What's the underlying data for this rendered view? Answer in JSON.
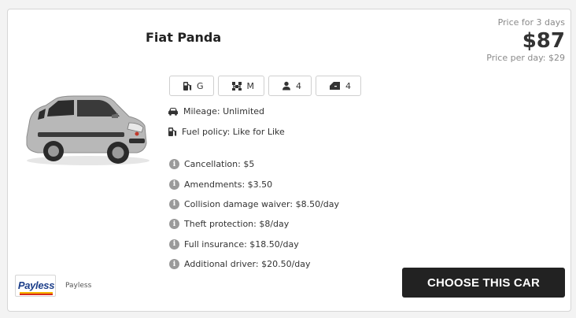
{
  "car": {
    "name": "Fiat Panda"
  },
  "price": {
    "caption": "Price for 3 days",
    "total": "$87",
    "per_day": "Price per day: $29"
  },
  "features": [
    {
      "icon": "fuel-pump-icon",
      "value": "G"
    },
    {
      "icon": "gearbox-icon",
      "value": "M"
    },
    {
      "icon": "person-icon",
      "value": "4"
    },
    {
      "icon": "car-door-icon",
      "value": "4"
    }
  ],
  "mileage": "Mileage: Unlimited",
  "fuel_policy": "Fuel policy: Like for Like",
  "extras": [
    "Cancellation: $5",
    "Amendments: $3.50",
    "Collision damage waiver: $8.50/day",
    "Theft protection: $8/day",
    "Full insurance: $18.50/day",
    "Additional driver: $20.50/day"
  ],
  "supplier": {
    "logo_text": "Payless",
    "name": "Payless"
  },
  "cta": {
    "label": "CHOOSE THIS CAR"
  },
  "colors": {
    "cta_bg": "#222222",
    "logo_blue": "#1d3f8a",
    "logo_yellow": "#f5b400",
    "logo_red": "#d62b1e"
  }
}
